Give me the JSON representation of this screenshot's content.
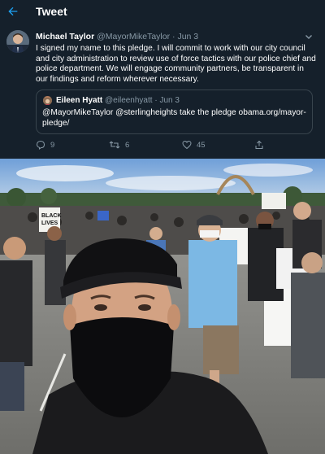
{
  "header": {
    "title": "Tweet",
    "back_icon": "arrow-left-icon"
  },
  "tweet": {
    "author_name": "Michael Taylor",
    "author_handle": "@MayorMikeTaylor",
    "separator": "·",
    "date": "Jun 3",
    "text": "I signed my name to this pledge. I will commit to work with our city council and city administration to review use of force tactics with our police chief and police department. We will engage community partners, be transparent in our findings and reform wherever necessary.",
    "more_icon": "chevron-down-icon"
  },
  "quoted": {
    "author_name": "Eileen Hyatt",
    "author_handle": "@eileenhyatt",
    "separator": "·",
    "date": "Jun 3",
    "text": "@MayorMikeTaylor @sterlingheights take the pledge obama.org/mayor-pledge/"
  },
  "actions": {
    "reply_count": "9",
    "retweet_count": "6",
    "like_count": "45"
  },
  "photo": {
    "protest_sign_text": "BLACK LIVES"
  },
  "colors": {
    "background": "#15202b",
    "secondary_text": "#8899a6",
    "border": "#38444d"
  }
}
